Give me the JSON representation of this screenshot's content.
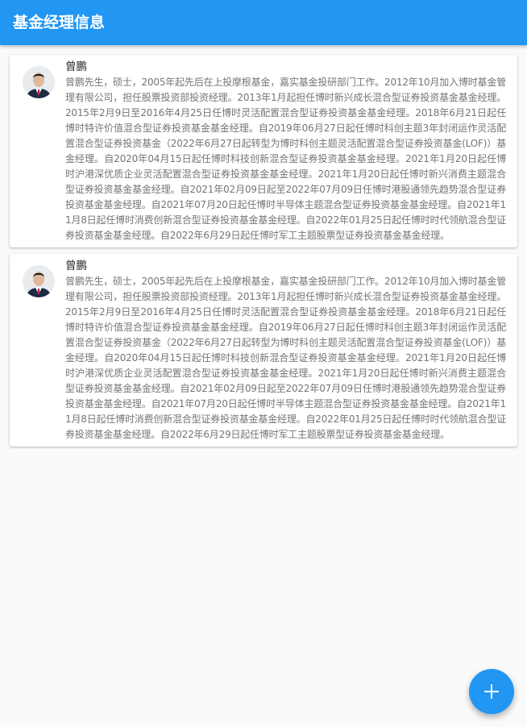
{
  "appbar": {
    "title": "基金经理信息"
  },
  "managers": [
    {
      "name": "曾鹏",
      "bio": "曾鹏先生，硕士，2005年起先后在上投摩根基金，嘉实基金投研部门工作。2012年10月加入博时基金管理有限公司，担任股票投资部投资经理。2013年1月起担任博时新兴成长混合型证券投资基金基金经理。2015年2月9日至2016年4月25日任博时灵活配置混合型证券投资基金基金经理。2018年6月21日起任博时特许价值混合型证券投资基金基金经理。自2019年06月27日起任博时科创主题3年封闭运作灵活配置混合型证券投资基金（2022年6月27日起转型为博时科创主题灵活配置混合型证券投资基金(LOF)）基金经理。自2020年04月15日起任博时科技创新混合型证券投资基金基金经理。2021年1月20日起任博时沪港深优质企业灵活配置混合型证券投资基金基金经理。2021年1月20日起任博时新兴消费主题混合型证券投资基金基金经理。自2021年02月09日起至2022年07月09日任博时港股通领先趋势混合型证券投资基金基金经理。自2021年07月20日起任博时半导体主题混合型证券投资基金基金经理。自2021年11月8日起任博时消费创新混合型证券投资基金基金经理。自2022年01月25日起任博时时代领航混合型证券投资基金基金经理。自2022年6月29日起任博时军工主题股票型证券投资基金基金经理。"
    },
    {
      "name": "曾鹏",
      "bio": "曾鹏先生，硕士，2005年起先后在上投摩根基金，嘉实基金投研部门工作。2012年10月加入博时基金管理有限公司，担任股票投资部投资经理。2013年1月起担任博时新兴成长混合型证券投资基金基金经理。2015年2月9日至2016年4月25日任博时灵活配置混合型证券投资基金基金经理。2018年6月21日起任博时特许价值混合型证券投资基金基金经理。自2019年06月27日起任博时科创主题3年封闭运作灵活配置混合型证券投资基金（2022年6月27日起转型为博时科创主题灵活配置混合型证券投资基金(LOF)）基金经理。自2020年04月15日起任博时科技创新混合型证券投资基金基金经理。2021年1月20日起任博时沪港深优质企业灵活配置混合型证券投资基金基金经理。2021年1月20日起任博时新兴消费主题混合型证券投资基金基金经理。自2021年02月09日起至2022年07月09日任博时港股通领先趋势混合型证券投资基金基金经理。自2021年07月20日起任博时半导体主题混合型证券投资基金基金经理。自2021年11月8日起任博时消费创新混合型证券投资基金基金经理。自2022年01月25日起任博时时代领航混合型证券投资基金基金经理。自2022年6月29日起任博时军工主题股票型证券投资基金基金经理。"
    }
  ],
  "fab": {
    "icon": "add-icon"
  },
  "colors": {
    "primary": "#2196f3",
    "name_text": "#212121",
    "bio_text": "#757575",
    "background": "#fafafa"
  }
}
